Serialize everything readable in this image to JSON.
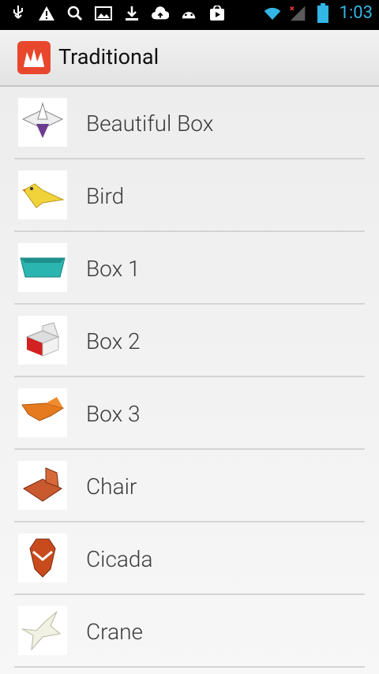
{
  "status_bar": {
    "time": "1:03",
    "icons": [
      "usb-icon",
      "warning-icon",
      "search-icon",
      "image-icon",
      "download-icon",
      "cloud-upload-icon",
      "android-icon",
      "play-store-icon"
    ],
    "right_icons": [
      "wifi-icon",
      "signal-icon",
      "battery-icon"
    ]
  },
  "action_bar": {
    "title": "Traditional",
    "icon": "origami-crown-icon",
    "icon_color": "#e8472e"
  },
  "list": {
    "items": [
      {
        "label": "Beautiful Box",
        "thumb": "beautiful-box-thumbnail"
      },
      {
        "label": "Bird",
        "thumb": "bird-thumbnail"
      },
      {
        "label": "Box 1",
        "thumb": "box1-thumbnail"
      },
      {
        "label": "Box 2",
        "thumb": "box2-thumbnail"
      },
      {
        "label": "Box 3",
        "thumb": "box3-thumbnail"
      },
      {
        "label": "Chair",
        "thumb": "chair-thumbnail"
      },
      {
        "label": "Cicada",
        "thumb": "cicada-thumbnail"
      },
      {
        "label": "Crane",
        "thumb": "crane-thumbnail"
      }
    ]
  }
}
